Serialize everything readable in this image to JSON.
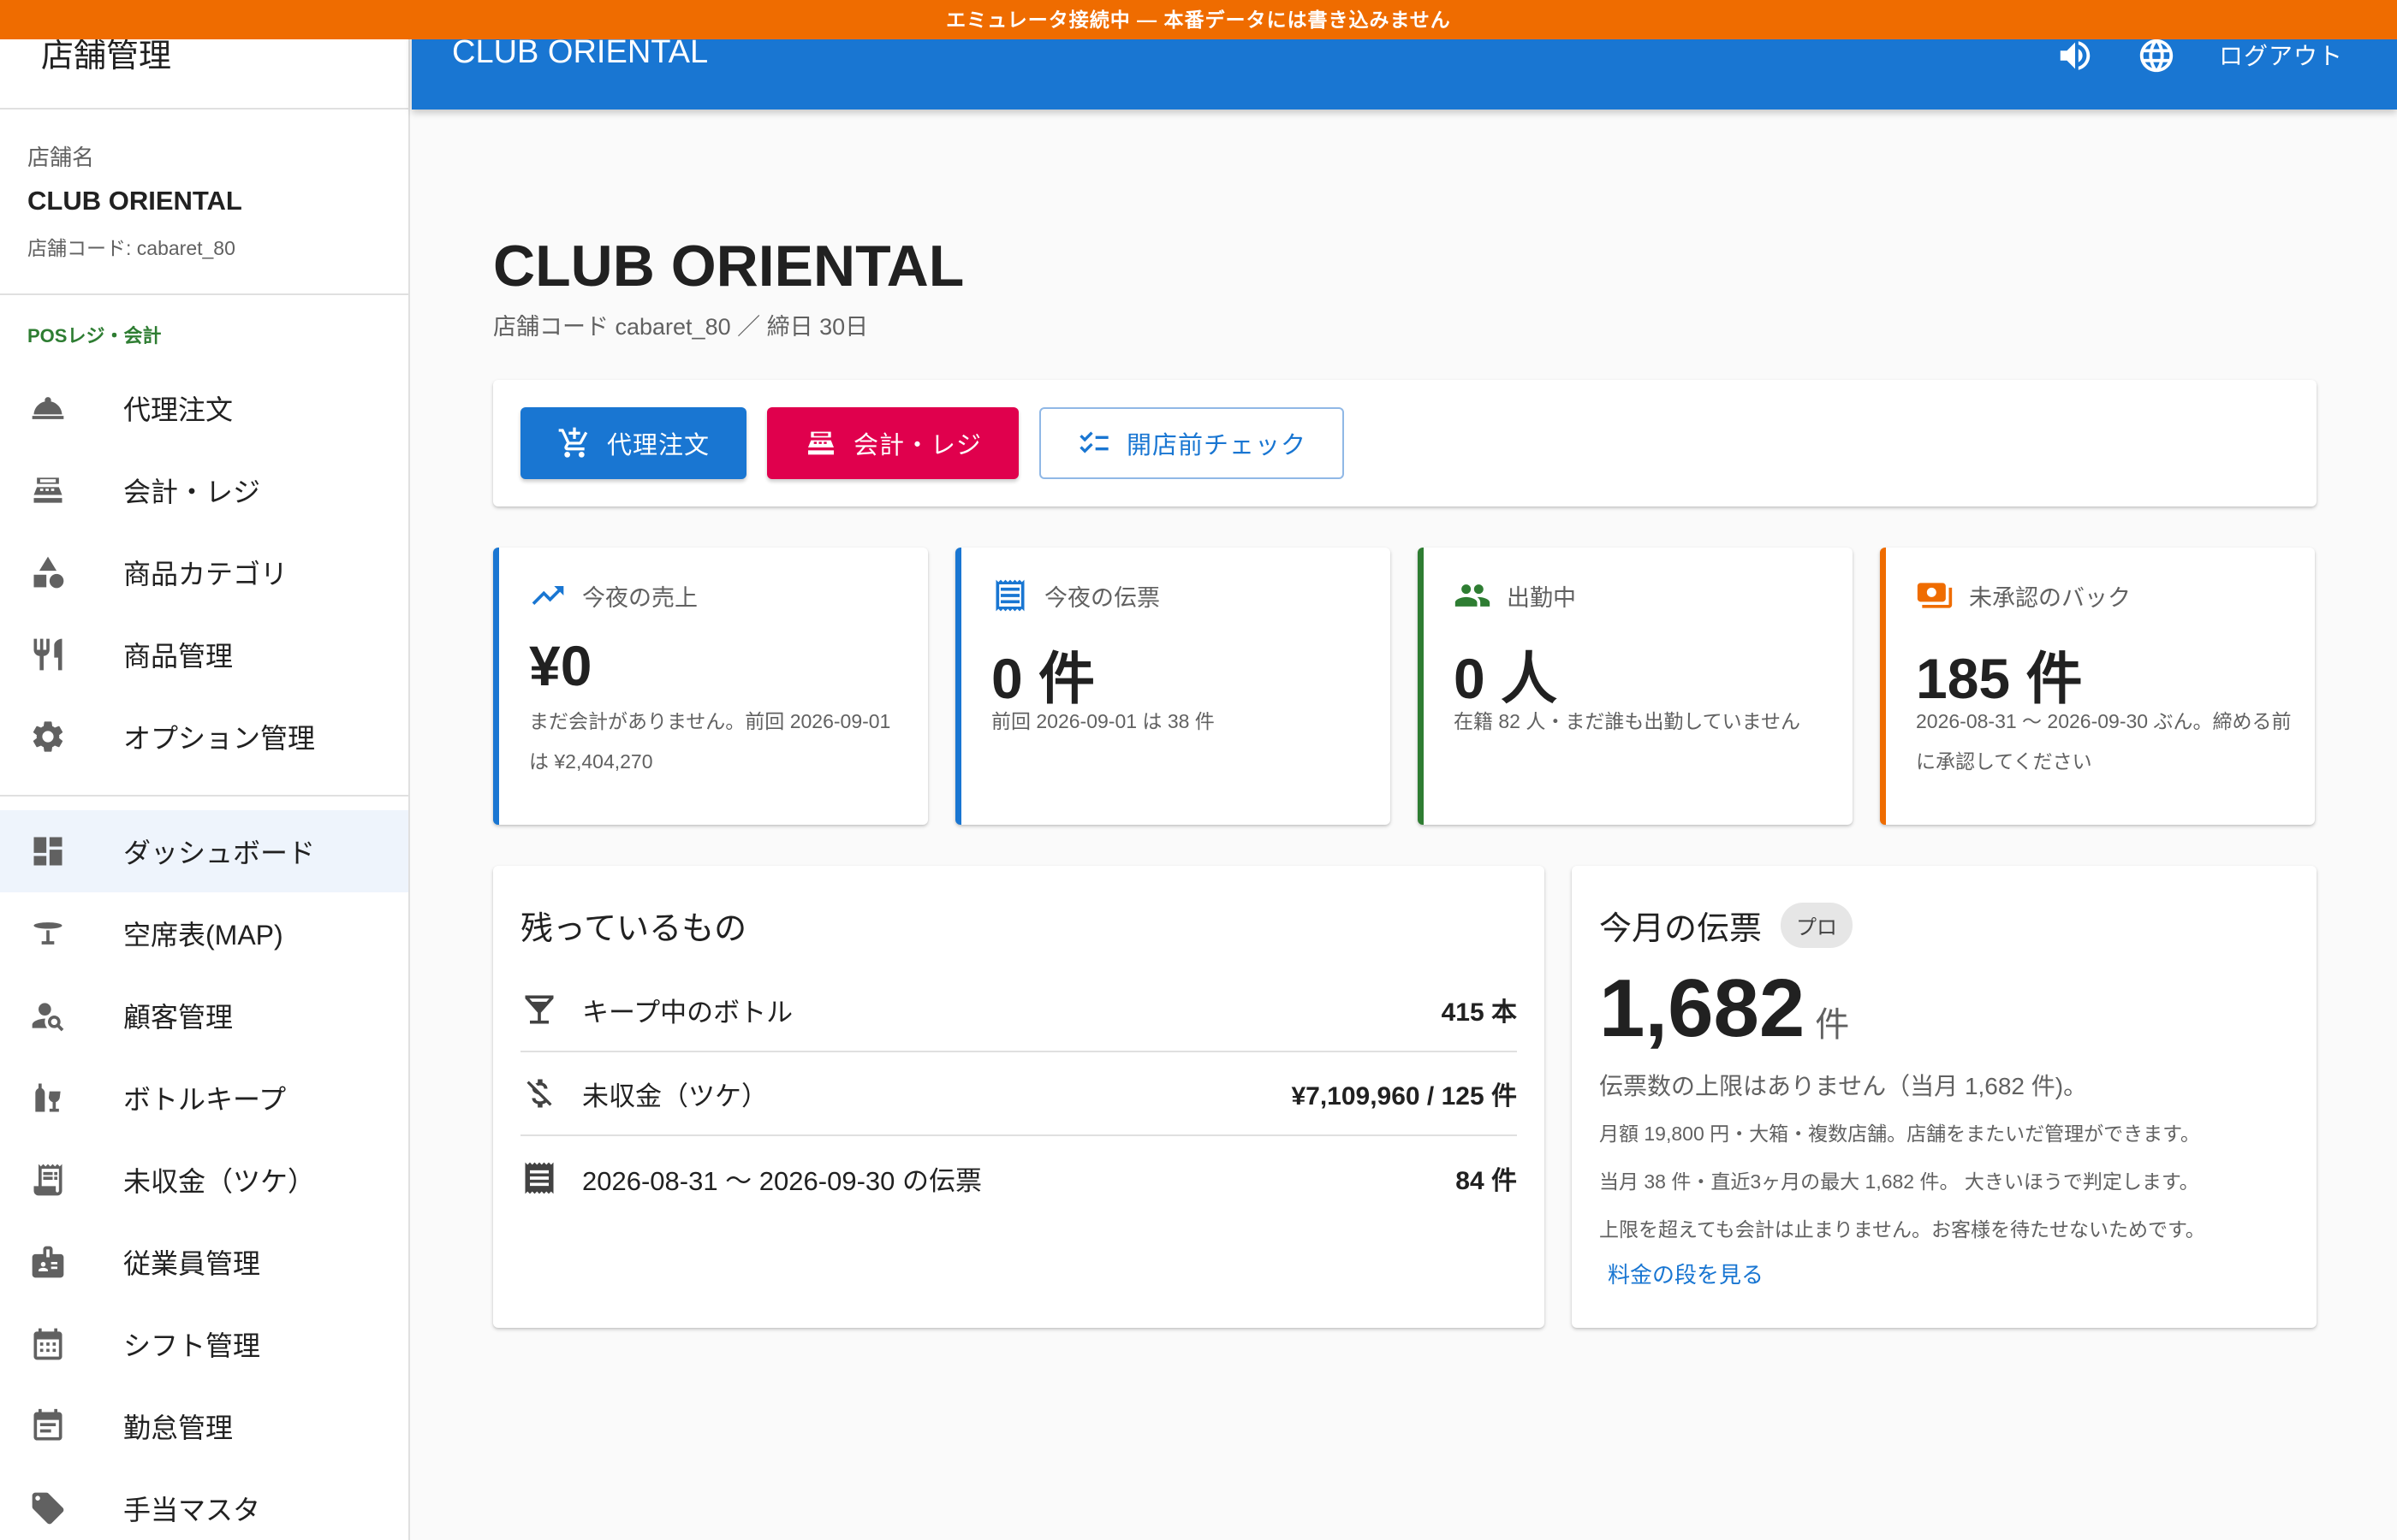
{
  "banner": "エミュレータ接続中 — 本番データには書き込みません",
  "sidebar": {
    "header": "店舗管理",
    "store_label": "店舗名",
    "store_name": "CLUB ORIENTAL",
    "store_code": "店舗コード: cabaret_80",
    "section": "POSレジ・会計",
    "items_top": [
      {
        "label": "代理注文",
        "icon": "room-service-icon"
      },
      {
        "label": "会計・レジ",
        "icon": "cash-register-icon"
      },
      {
        "label": "商品カテゴリ",
        "icon": "category-icon"
      },
      {
        "label": "商品管理",
        "icon": "restaurant-icon"
      },
      {
        "label": "オプション管理",
        "icon": "gear-icon"
      }
    ],
    "items_bottom": [
      {
        "label": "ダッシュボード",
        "icon": "dashboard-icon",
        "active": true
      },
      {
        "label": "空席表(MAP)",
        "icon": "table-icon"
      },
      {
        "label": "顧客管理",
        "icon": "person-search-icon"
      },
      {
        "label": "ボトルキープ",
        "icon": "bottle-icon"
      },
      {
        "label": "未収金（ツケ）",
        "icon": "receipt-icon"
      },
      {
        "label": "従業員管理",
        "icon": "badge-icon"
      },
      {
        "label": "シフト管理",
        "icon": "calendar-icon"
      },
      {
        "label": "勤怠管理",
        "icon": "event-note-icon"
      },
      {
        "label": "手当マスタ",
        "icon": "tag-icon"
      }
    ]
  },
  "appbar": {
    "title": "CLUB ORIENTAL",
    "sound_icon": "volume-icon",
    "lang_icon": "globe-icon",
    "logout": "ログアウト"
  },
  "page": {
    "title": "CLUB ORIENTAL",
    "subtitle": "店舗コード cabaret_80 ／ 締日 30日"
  },
  "actions": {
    "proxy_order": "代理注文",
    "register": "会計・レジ",
    "precheck": "開店前チェック"
  },
  "stats": [
    {
      "label": "今夜の売上",
      "value": "¥0",
      "note": "まだ会計がありません。前回 2026-09-01 は ¥2,404,270",
      "color": "#1976d2",
      "icon": "trending-up-icon"
    },
    {
      "label": "今夜の伝票",
      "value": "0 件",
      "note": "前回 2026-09-01 は 38 件",
      "color": "#1976d2",
      "icon": "receipt-long-icon"
    },
    {
      "label": "出勤中",
      "value": "0 人",
      "note": "在籍 82 人・まだ誰も出勤していません",
      "color": "#2e7d32",
      "icon": "people-icon"
    },
    {
      "label": "未承認のバック",
      "value": "185 件",
      "note": "2026-08-31 〜 2026-09-30 ぶん。締める前に承認してください",
      "color": "#ef6c00",
      "icon": "payments-icon"
    }
  ],
  "remaining": {
    "title": "残っているもの",
    "rows": [
      {
        "label": "キープ中のボトル",
        "value": "415 本",
        "icon": "cocktail-icon"
      },
      {
        "label": "未収金（ツケ）",
        "value": "¥7,109,960 / 125 件",
        "icon": "money-off-icon"
      },
      {
        "label": "2026-08-31 〜 2026-09-30 の伝票",
        "value": "84 件",
        "icon": "receipt-long-icon"
      }
    ]
  },
  "month": {
    "title": "今月の伝票",
    "chip": "プロ",
    "count": "1,682",
    "unit": "件",
    "line1": "伝票数の上限はありません（当月 1,682 件)。",
    "line2": "月額 19,800 円・大箱・複数店舗。店舗をまたいだ管理ができます。",
    "line3": "当月 38 件・直近3ヶ月の最大 1,682 件。 大きいほうで判定します。",
    "line4": "上限を超えても会計は止まりません。お客様を待たせないためです。",
    "link": "料金の段を見る"
  }
}
